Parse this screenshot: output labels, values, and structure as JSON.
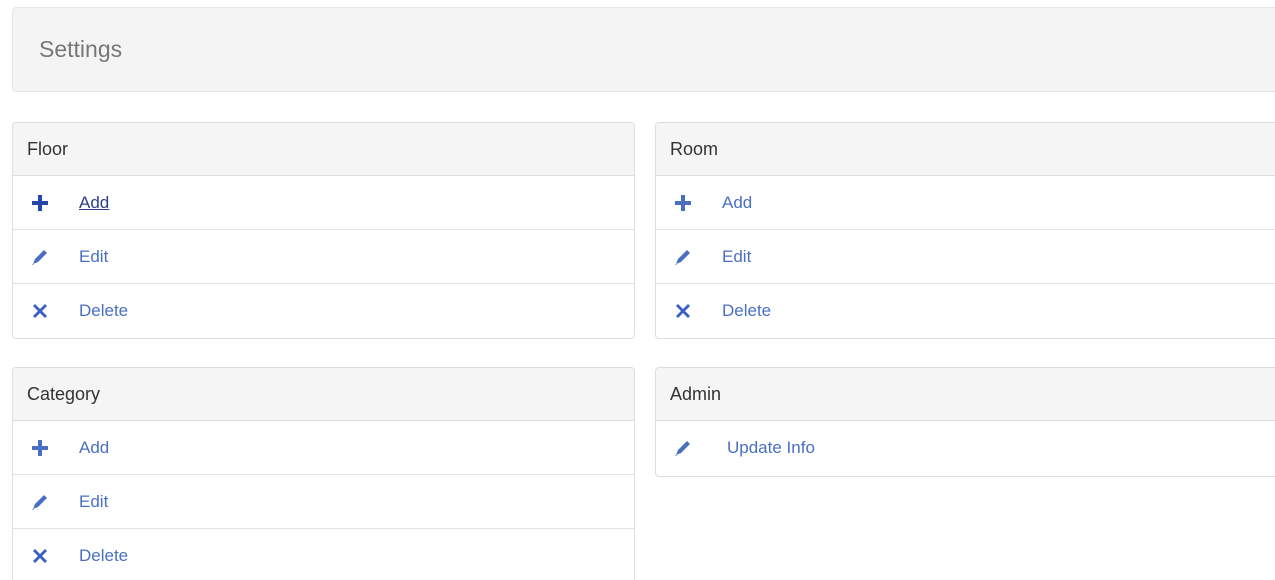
{
  "header": {
    "title": "Settings"
  },
  "colors": {
    "accent": "#4a6fc2",
    "icon_plus": "#2346a8",
    "icon_edit": "#4a6fc2",
    "icon_delete": "#3a5fc4"
  },
  "panels": {
    "floor": {
      "title": "Floor",
      "items": [
        {
          "label": "Add",
          "icon": "plus-icon"
        },
        {
          "label": "Edit",
          "icon": "pencil-icon"
        },
        {
          "label": "Delete",
          "icon": "close-icon"
        }
      ]
    },
    "room": {
      "title": "Room",
      "items": [
        {
          "label": "Add",
          "icon": "plus-icon"
        },
        {
          "label": "Edit",
          "icon": "pencil-icon"
        },
        {
          "label": "Delete",
          "icon": "close-icon"
        }
      ]
    },
    "category": {
      "title": "Category",
      "items": [
        {
          "label": "Add",
          "icon": "plus-icon"
        },
        {
          "label": "Edit",
          "icon": "pencil-icon"
        },
        {
          "label": "Delete",
          "icon": "close-icon"
        }
      ]
    },
    "admin": {
      "title": "Admin",
      "items": [
        {
          "label": "Update Info",
          "icon": "pencil-icon"
        }
      ]
    }
  }
}
